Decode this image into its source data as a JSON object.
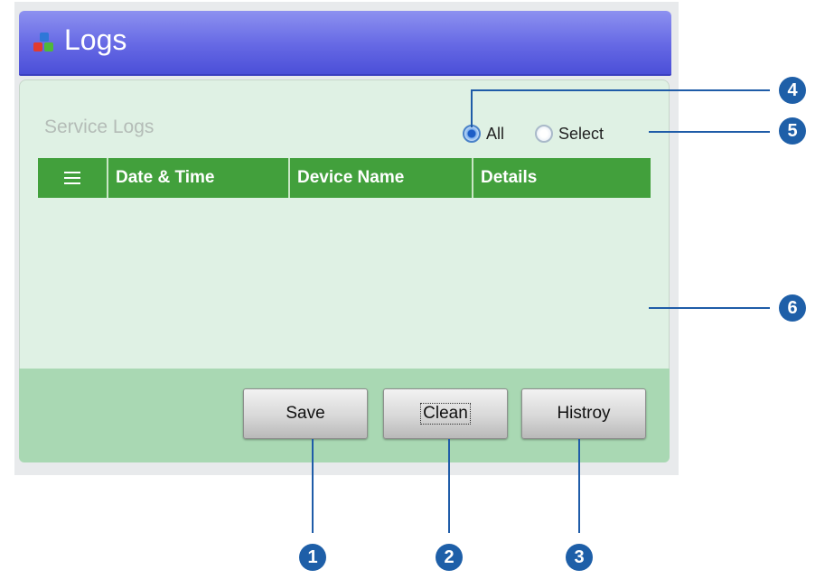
{
  "window": {
    "title": "Logs",
    "title_icon": "colored-blocks-icon"
  },
  "panel": {
    "title": "Service Logs",
    "filter": {
      "all_label": "All",
      "select_label": "Select",
      "selected": "All"
    },
    "table": {
      "columns": [
        "Date & Time",
        "Device Name",
        "Details"
      ],
      "list_icon": "list-icon",
      "rows": []
    }
  },
  "footer": {
    "buttons": {
      "save": "Save",
      "clean": "Clean",
      "history": "Histroy"
    }
  },
  "callouts": [
    "1",
    "2",
    "3",
    "4",
    "5",
    "6"
  ],
  "colors": {
    "titlebar": "#6568e4",
    "panel_bg": "#dff1e4",
    "table_header": "#42a03c",
    "footer_bg": "#a9d8b3",
    "callout": "#1e5fa8"
  }
}
